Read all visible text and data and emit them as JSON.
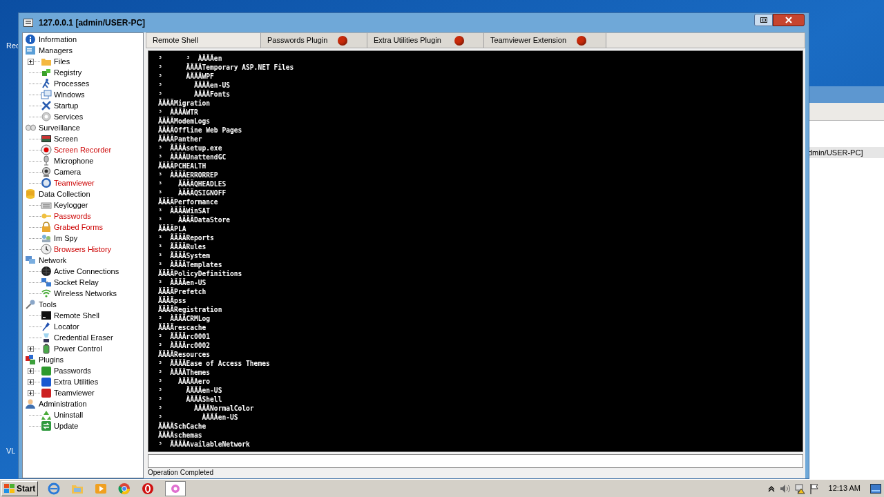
{
  "desktop": {
    "icon_labels": [
      "Rec",
      "VL"
    ]
  },
  "background_window": {
    "row_text": "dmin/USER-PC]"
  },
  "window": {
    "title": "127.0.0.1 [admin/USER-PC]"
  },
  "sidebar": {
    "items": [
      {
        "label": "Information"
      },
      {
        "label": "Managers",
        "children": [
          {
            "label": "Files",
            "collapsed": true
          },
          {
            "label": "Registry",
            "collapsed": false
          },
          {
            "label": "Processes",
            "collapsed": false
          },
          {
            "label": "Windows",
            "collapsed": false
          },
          {
            "label": "Startup",
            "collapsed": false
          },
          {
            "label": "Services",
            "collapsed": false
          }
        ]
      },
      {
        "label": "Surveillance",
        "children": [
          {
            "label": "Screen",
            "collapsed": false
          },
          {
            "label": "Screen Recorder",
            "color": "#cc0000",
            "collapsed": false
          },
          {
            "label": "Microphone",
            "collapsed": false
          },
          {
            "label": "Camera",
            "collapsed": false
          },
          {
            "label": "Teamviewer",
            "color": "#cc0000",
            "collapsed": false
          }
        ]
      },
      {
        "label": "Data Collection",
        "children": [
          {
            "label": "Keylogger",
            "collapsed": false
          },
          {
            "label": "Passwords",
            "color": "#cc0000",
            "collapsed": false
          },
          {
            "label": "Grabed Forms",
            "color": "#cc0000",
            "collapsed": false
          },
          {
            "label": "Im Spy",
            "collapsed": false
          },
          {
            "label": "Browsers History",
            "color": "#cc0000",
            "collapsed": false
          }
        ]
      },
      {
        "label": "Network",
        "children": [
          {
            "label": "Active Connections",
            "collapsed": false
          },
          {
            "label": "Socket Relay",
            "collapsed": false
          },
          {
            "label": "Wireless Networks",
            "collapsed": false
          }
        ]
      },
      {
        "label": "Tools",
        "children": [
          {
            "label": "Remote Shell",
            "collapsed": false
          },
          {
            "label": "Locator",
            "collapsed": false
          },
          {
            "label": "Credential Eraser",
            "collapsed": false
          },
          {
            "label": "Power Control",
            "collapsed": true
          }
        ]
      },
      {
        "label": "Plugins",
        "children": [
          {
            "label": "Passwords",
            "collapsed": true
          },
          {
            "label": "Extra Utilities",
            "collapsed": true
          },
          {
            "label": "Teamviewer",
            "collapsed": true
          }
        ]
      },
      {
        "label": "Administration",
        "children": [
          {
            "label": "Uninstall",
            "collapsed": false
          },
          {
            "label": "Update",
            "collapsed": false
          }
        ]
      }
    ]
  },
  "tabs": [
    {
      "label": "Remote Shell",
      "selected": true,
      "dot": false
    },
    {
      "label": "Passwords Plugin",
      "selected": false,
      "dot": true
    },
    {
      "label": "Extra Utilities Plugin",
      "selected": false,
      "dot": true
    },
    {
      "label": "Teamviewer Extension",
      "selected": false,
      "dot": true
    }
  ],
  "console": {
    "lines": [
      "³      ³  ÀÄÄÄen",
      "³      ÃÄÄÄTemporary ASP.NET Files",
      "³      ÀÄÄÄWPF",
      "³        ÃÄÄÄen-US",
      "³        ÀÄÄÄFonts",
      "ÃÄÄÄMigration",
      "³  ÀÄÄÄWTR",
      "ÃÄÄÄModemLogs",
      "ÃÄÄÄOffline Web Pages",
      "ÃÄÄÄPanther",
      "³  ÃÄÄÄsetup.exe",
      "³  ÀÄÄÄUnattendGC",
      "ÃÄÄÄPCHEALTH",
      "³  ÀÄÄÄERRORREP",
      "³    ÃÄÄÄQHEADLES",
      "³    ÀÄÄÄQSIGNOFF",
      "ÃÄÄÄPerformance",
      "³  ÀÄÄÄWinSAT",
      "³    ÀÄÄÄDataStore",
      "ÃÄÄÄPLA",
      "³  ÃÄÄÄReports",
      "³  ÃÄÄÄRules",
      "³  ÃÄÄÄSystem",
      "³  ÀÄÄÄTemplates",
      "ÃÄÄÄPolicyDefinitions",
      "³  ÀÄÄÄen-US",
      "ÃÄÄÄPrefetch",
      "ÃÄÄÄpss",
      "ÃÄÄÄRegistration",
      "³  ÀÄÄÄCRMLog",
      "ÃÄÄÄrescache",
      "³  ÃÄÄÄrc0001",
      "³  ÀÄÄÄrc0002",
      "ÃÄÄÄResources",
      "³  ÃÄÄÄEase of Access Themes",
      "³  ÀÄÄÄThemes",
      "³    ÀÄÄÄAero",
      "³      ÃÄÄÄen-US",
      "³      ÀÄÄÄShell",
      "³        ÀÄÄÄNormalColor",
      "³          ÀÄÄÄen-US",
      "ÃÄÄÄSchCache",
      "ÃÄÄÄschemas",
      "³  ÃÄÄÄAvailableNetwork"
    ]
  },
  "status_bar": {
    "text": "Operation Completed"
  },
  "taskbar": {
    "start": "Start",
    "clock": "12:13 AM"
  }
}
